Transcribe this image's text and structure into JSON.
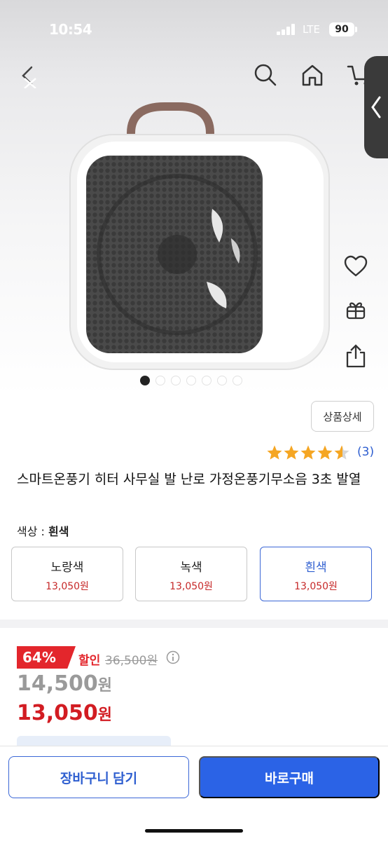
{
  "status_bar": {
    "time": "10:54",
    "network": "LTE",
    "battery": "90"
  },
  "nav": {
    "back_icon": "back-arrow-icon",
    "icons": [
      "search-icon",
      "home-icon",
      "cart-icon"
    ]
  },
  "gallery": {
    "image_count": 7,
    "active_index": 0
  },
  "actions": [
    "heart-icon",
    "gift-icon",
    "share-icon"
  ],
  "detail_button": "상품상세",
  "rating": {
    "stars": 4.5,
    "review_count": "(3)"
  },
  "product": {
    "title": "스마트온풍기 히터 사무실 발 난로 가정온풍기무소음 3초 발열"
  },
  "color": {
    "label": "색상 : ",
    "selected": "흰색",
    "options": [
      {
        "name": "노랑색",
        "price": "13,050원"
      },
      {
        "name": "녹색",
        "price": "13,050원"
      },
      {
        "name": "흰색",
        "price": "13,050원"
      }
    ]
  },
  "price": {
    "discount_rate": "64%",
    "sale_label": "할인",
    "original": "36,500원",
    "list_value": "14,500",
    "final_value": "13,050",
    "currency": "원"
  },
  "bottom": {
    "cart_label": "장바구니 담기",
    "buy_label": "바로구매"
  },
  "colors": {
    "accent": "#2b63e6",
    "sale": "#e3262c",
    "star": "#f5a623"
  }
}
